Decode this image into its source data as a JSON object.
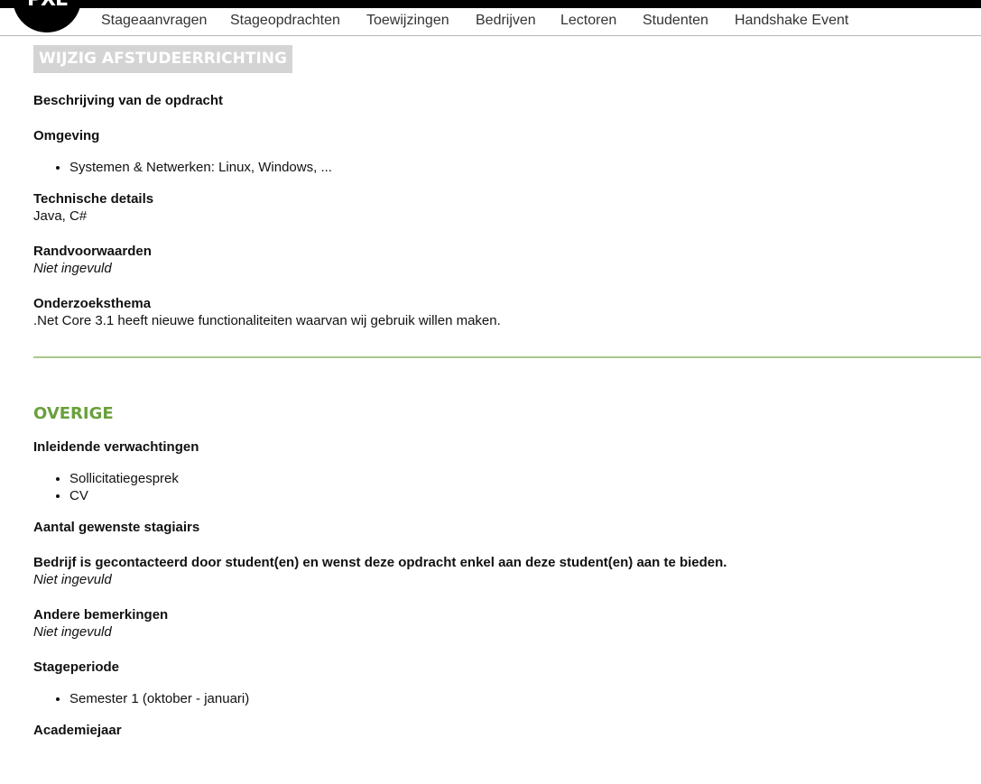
{
  "logo": {
    "text": "PXL"
  },
  "nav": {
    "items": [
      {
        "label": "Stageaanvragen"
      },
      {
        "label": "Stageopdrachten"
      },
      {
        "label": "Toewijzingen"
      },
      {
        "label": "Bedrijven"
      },
      {
        "label": "Lectoren"
      },
      {
        "label": "Studenten"
      },
      {
        "label": "Handshake Event"
      }
    ]
  },
  "page": {
    "title": "WIJZIG AFSTUDEERRICHTING"
  },
  "assignment": {
    "description_label": "Beschrijving van de opdracht",
    "environment_label": "Omgeving",
    "environment_items": [
      "Systemen & Netwerken: Linux, Windows, ..."
    ],
    "technical_label": "Technische details",
    "technical_value": "Java, C#",
    "conditions_label": "Randvoorwaarden",
    "conditions_value": "Niet ingevuld",
    "research_label": "Onderzoeksthema",
    "research_value": ".Net Core 3.1 heeft nieuwe functionaliteiten waarvan wij gebruik willen maken."
  },
  "other": {
    "title": "OVERIGE",
    "expectations_label": "Inleidende verwachtingen",
    "expectations_items": [
      "Sollicitatiegesprek",
      "CV"
    ],
    "interns_label": "Aantal gewenste stagiairs",
    "contacted_label": "Bedrijf is gecontacteerd door student(en) en wenst deze opdracht enkel aan deze student(en) aan te bieden.",
    "contacted_value": "Niet ingevuld",
    "remarks_label": "Andere bemerkingen",
    "remarks_value": "Niet ingevuld",
    "period_label": "Stageperiode",
    "period_items": [
      "Semester 1 (oktober - januari)"
    ],
    "year_label": "Academiejaar"
  },
  "colors": {
    "accent_green": "#6aa03c",
    "divider_green": "#a9c98a",
    "title_bg": "#d4d4d4",
    "topbar": "#000000"
  }
}
